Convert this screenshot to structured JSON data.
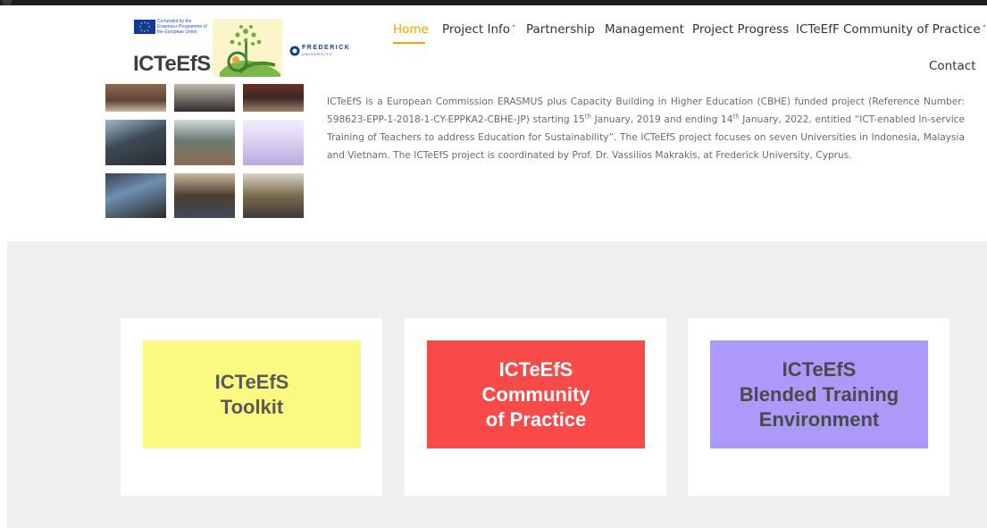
{
  "header": {
    "eu_text": "Co-funded by the Erasmus+ Programme of the European Union",
    "brand": "ICTeEfS",
    "partner_name": "FREDERICK",
    "partner_sub": "UNIVERSITY"
  },
  "nav": {
    "items": [
      {
        "label": "Home",
        "active": true
      },
      {
        "label": "Project Info"
      },
      {
        "label": "Partnership"
      },
      {
        "label": "Management"
      },
      {
        "label": "Project Progress"
      },
      {
        "label": "ICTeEfF Community of Practice"
      },
      {
        "label": "Contact"
      }
    ],
    "chevron": "˅",
    "accent": "#f0a500"
  },
  "intro": {
    "t1": "ICTeEfS is a European Commission ERASMUS plus Capacity Building in Higher Education (CBHE) funded project (Reference Number: 598623-EPP-1-2018-1-CY-EPPKA2-CBHE-JP) starting 15",
    "sup1": "th",
    "t2": " January, 2019 and ending 14",
    "sup2": "th",
    "t3": " January, 2022, entitled “ICT-enabled In-service Training of Teachers to address Education for Sustainability”. The ICTeEfS project focuses on seven Universities in Indonesia, Malaysia and Vietnam. The ICTeEfS project is coordinated by Prof. Dr. Vassilios Makrakis, at Frederick University, Cyprus."
  },
  "cards": [
    {
      "text": "ICTeEfS\nToolkit",
      "bg": "#fafa82",
      "color": "#5a5a5a"
    },
    {
      "text": "ICTeEfS\nCommunity\nof Practice",
      "bg": "#f94a4a",
      "color": "#ffffff"
    },
    {
      "text": "ICTeEfS\nBlended Training\nEnvironment",
      "bg": "#ad99fa",
      "color": "#4a4a4a"
    }
  ]
}
